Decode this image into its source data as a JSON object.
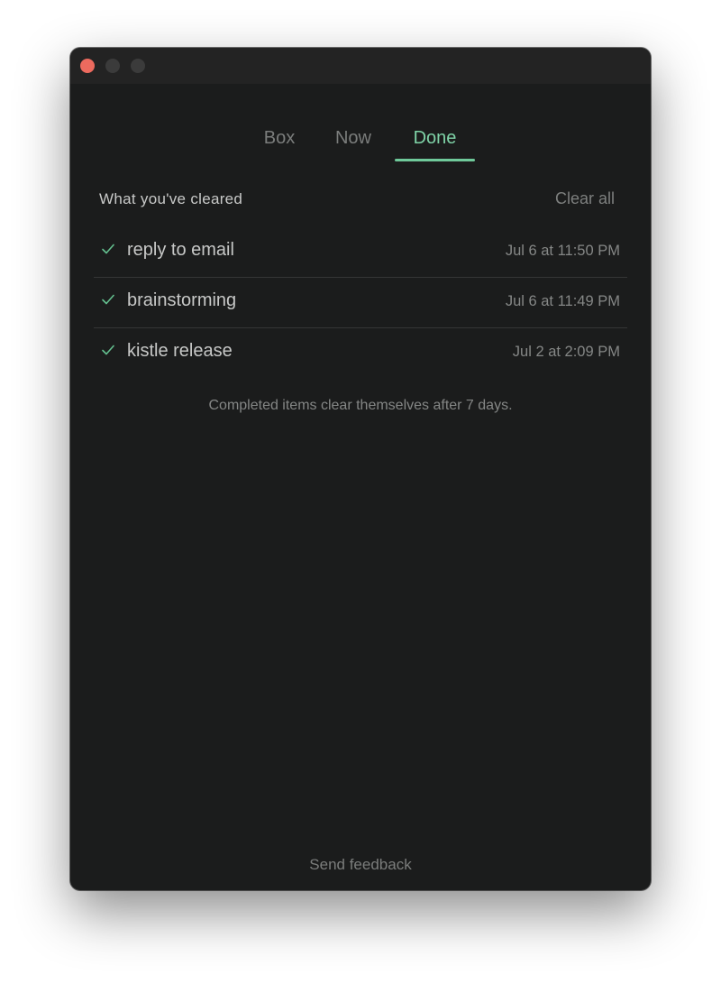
{
  "window": {
    "traffic_lights": [
      "close",
      "minimize",
      "zoom"
    ]
  },
  "tabs": [
    {
      "label": "Box",
      "active": false
    },
    {
      "label": "Now",
      "active": false
    },
    {
      "label": "Done",
      "active": true
    }
  ],
  "section": {
    "title": "What you've cleared",
    "clear_all_label": "Clear all"
  },
  "items": [
    {
      "title": "reply to email",
      "time": "Jul 6 at 11:50 PM",
      "icon": "check-icon"
    },
    {
      "title": "brainstorming",
      "time": "Jul 6 at 11:49 PM",
      "icon": "check-icon"
    },
    {
      "title": "kistle release",
      "time": "Jul 2 at 2:09 PM",
      "icon": "check-icon"
    }
  ],
  "note": "Completed items clear themselves after 7 days.",
  "footer": {
    "feedback_label": "Send feedback"
  },
  "colors": {
    "background": "#1b1c1c",
    "accent": "#7fd3a7",
    "close_button": "#ec6a5e"
  }
}
